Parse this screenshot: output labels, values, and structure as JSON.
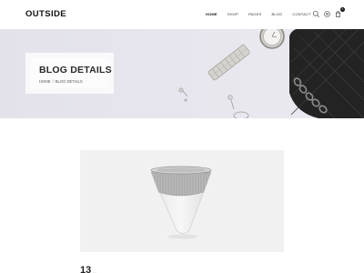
{
  "brand": {
    "logo": "OUTSIDE"
  },
  "nav": {
    "items": [
      {
        "label": "HOME",
        "active": true
      },
      {
        "label": "SHOP",
        "active": false
      },
      {
        "label": "PAGES",
        "active": false
      },
      {
        "label": "BLOG",
        "active": false
      },
      {
        "label": "CONTACT",
        "active": false
      }
    ]
  },
  "header_icons": {
    "search": "search-icon",
    "settings": "gear-icon",
    "cart": "cart-icon",
    "cart_count": "0"
  },
  "hero": {
    "title": "BLOG DETAILS",
    "breadcrumb": {
      "home": "HOME",
      "separator": "/",
      "current": "BLOG DETAILS"
    }
  },
  "post": {
    "date_day": "13",
    "date_suffix": "..."
  },
  "colors": {
    "accent": "#111111",
    "hero_bg": "#e6e5ed",
    "product_bg": "#f1f1f1"
  }
}
